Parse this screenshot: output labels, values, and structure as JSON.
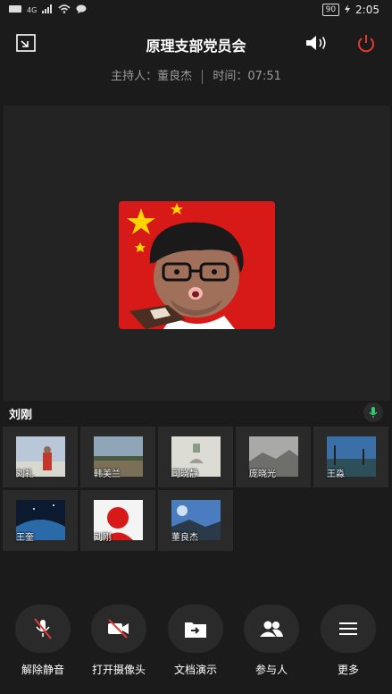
{
  "status_bar": {
    "signal_text": "4G",
    "battery": "90",
    "time": "2:05"
  },
  "header": {
    "title": "原理支部党员会"
  },
  "meeting_info": {
    "host_label": "主持人：董良杰",
    "time_label": "时间：07:51"
  },
  "active_speaker": {
    "name": "刘刚"
  },
  "participants": [
    {
      "name": "刘礼"
    },
    {
      "name": "韩美兰"
    },
    {
      "name": "司晓静"
    },
    {
      "name": "庞晓光"
    },
    {
      "name": "王淼"
    },
    {
      "name": "王奎"
    },
    {
      "name": "刘刚"
    },
    {
      "name": "董良杰"
    }
  ],
  "toolbar": {
    "unmute": "解除静音",
    "camera": "打开摄像头",
    "share": "文档演示",
    "participants": "参与人",
    "more": "更多"
  }
}
